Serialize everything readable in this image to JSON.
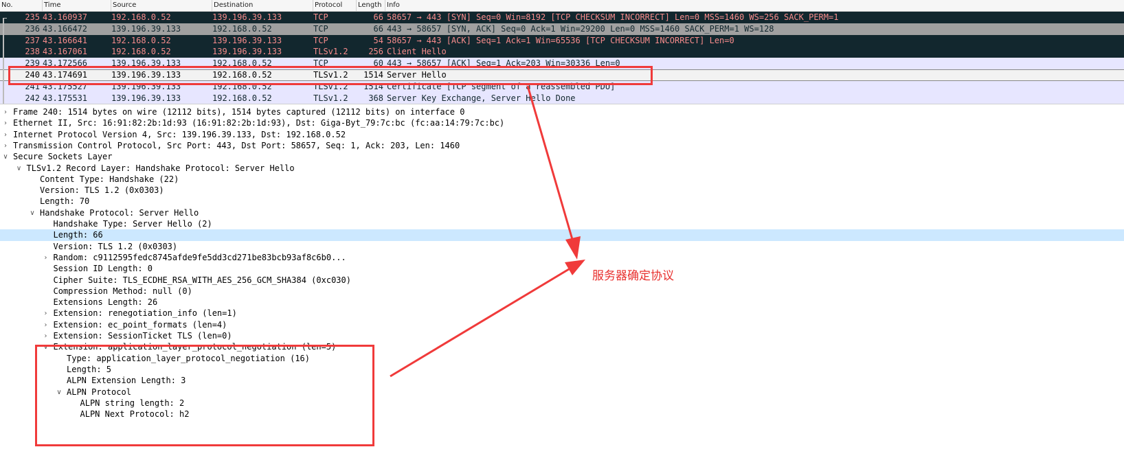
{
  "packet_list": {
    "columns": [
      "No.",
      "Time",
      "Source",
      "Destination",
      "Protocol",
      "Length",
      "Info"
    ],
    "rows": [
      {
        "no": "235",
        "time": "43.160937",
        "src": "192.168.0.52",
        "dst": "139.196.39.133",
        "proto": "TCP",
        "len": "66",
        "info": "58657 → 443 [SYN] Seq=0 Win=8192 [TCP CHECKSUM INCORRECT] Len=0 MSS=1460 WS=256 SACK_PERM=1"
      },
      {
        "no": "236",
        "time": "43.166472",
        "src": "139.196.39.133",
        "dst": "192.168.0.52",
        "proto": "TCP",
        "len": "66",
        "info": "443 → 58657 [SYN, ACK] Seq=0 Ack=1 Win=29200 Len=0 MSS=1460 SACK_PERM=1 WS=128"
      },
      {
        "no": "237",
        "time": "43.166641",
        "src": "192.168.0.52",
        "dst": "139.196.39.133",
        "proto": "TCP",
        "len": "54",
        "info": "58657 → 443 [ACK] Seq=1 Ack=1 Win=65536 [TCP CHECKSUM INCORRECT] Len=0"
      },
      {
        "no": "238",
        "time": "43.167061",
        "src": "192.168.0.52",
        "dst": "139.196.39.133",
        "proto": "TLSv1.2",
        "len": "256",
        "info": "Client Hello"
      },
      {
        "no": "239",
        "time": "43.172566",
        "src": "139.196.39.133",
        "dst": "192.168.0.52",
        "proto": "TCP",
        "len": "60",
        "info": "443 → 58657 [ACK] Seq=1 Ack=203 Win=30336 Len=0"
      },
      {
        "no": "240",
        "time": "43.174691",
        "src": "139.196.39.133",
        "dst": "192.168.0.52",
        "proto": "TLSv1.2",
        "len": "1514",
        "info": "Server Hello"
      },
      {
        "no": "241",
        "time": "43.175527",
        "src": "139.196.39.133",
        "dst": "192.168.0.52",
        "proto": "TLSv1.2",
        "len": "1514",
        "info": "Certificate [TCP segment of a reassembled PDU]"
      },
      {
        "no": "242",
        "time": "43.175531",
        "src": "139.196.39.133",
        "dst": "192.168.0.52",
        "proto": "TLSv1.2",
        "len": "368",
        "info": "Server Key Exchange, Server Hello Done"
      }
    ]
  },
  "row_colors": {
    "dark_bg": "#12272e",
    "dark_fg": "#f78c8c",
    "gray_bg": "#a0a0a0",
    "gray_fg": "#12272e",
    "tcp_bg": "#e7e6ff",
    "tls_selected_bg": "#f2f2f2"
  },
  "detail_tree": [
    {
      "text": "Frame 240: 1514 bytes on wire (12112 bits), 1514 bytes captured (12112 bits) on interface 0",
      "arrow": "collapsed"
    },
    {
      "text": "Ethernet II, Src: 16:91:82:2b:1d:93 (16:91:82:2b:1d:93), Dst: Giga-Byt_79:7c:bc (fc:aa:14:79:7c:bc)",
      "arrow": "collapsed"
    },
    {
      "text": "Internet Protocol Version 4, Src: 139.196.39.133, Dst: 192.168.0.52",
      "arrow": "collapsed"
    },
    {
      "text": "Transmission Control Protocol, Src Port: 443, Dst Port: 58657, Seq: 1, Ack: 203, Len: 1460",
      "arrow": "collapsed"
    },
    {
      "text": "Secure Sockets Layer",
      "arrow": "expanded"
    },
    {
      "text": "TLSv1.2 Record Layer: Handshake Protocol: Server Hello",
      "arrow": "expanded"
    },
    {
      "text": "Content Type: Handshake (22)",
      "arrow": "none"
    },
    {
      "text": "Version: TLS 1.2 (0x0303)",
      "arrow": "none"
    },
    {
      "text": "Length: 70",
      "arrow": "none"
    },
    {
      "text": "Handshake Protocol: Server Hello",
      "arrow": "expanded"
    },
    {
      "text": "Handshake Type: Server Hello (2)",
      "arrow": "none"
    },
    {
      "text": "Length: 66",
      "arrow": "none"
    },
    {
      "text": "Version: TLS 1.2 (0x0303)",
      "arrow": "none"
    },
    {
      "text": "Random: c9112595fedc8745afde9fe5dd3cd271be83bcb93af8c6b0...",
      "arrow": "collapsed"
    },
    {
      "text": "Session ID Length: 0",
      "arrow": "none"
    },
    {
      "text": "Cipher Suite: TLS_ECDHE_RSA_WITH_AES_256_GCM_SHA384 (0xc030)",
      "arrow": "none"
    },
    {
      "text": "Compression Method: null (0)",
      "arrow": "none"
    },
    {
      "text": "Extensions Length: 26",
      "arrow": "none"
    },
    {
      "text": "Extension: renegotiation_info (len=1)",
      "arrow": "collapsed"
    },
    {
      "text": "Extension: ec_point_formats (len=4)",
      "arrow": "collapsed"
    },
    {
      "text": "Extension: SessionTicket TLS (len=0)",
      "arrow": "collapsed"
    },
    {
      "text": "Extension: application_layer_protocol_negotiation (len=5)",
      "arrow": "expanded"
    },
    {
      "text": "Type: application_layer_protocol_negotiation (16)",
      "arrow": "none"
    },
    {
      "text": "Length: 5",
      "arrow": "none"
    },
    {
      "text": "ALPN Extension Length: 3",
      "arrow": "none"
    },
    {
      "text": "ALPN Protocol",
      "arrow": "expanded"
    },
    {
      "text": "ALPN string length: 2",
      "arrow": "none"
    },
    {
      "text": "ALPN Next Protocol: h2",
      "arrow": "none"
    }
  ],
  "annotation": {
    "label": "服务器确定协议",
    "color": "#f03a3a"
  }
}
